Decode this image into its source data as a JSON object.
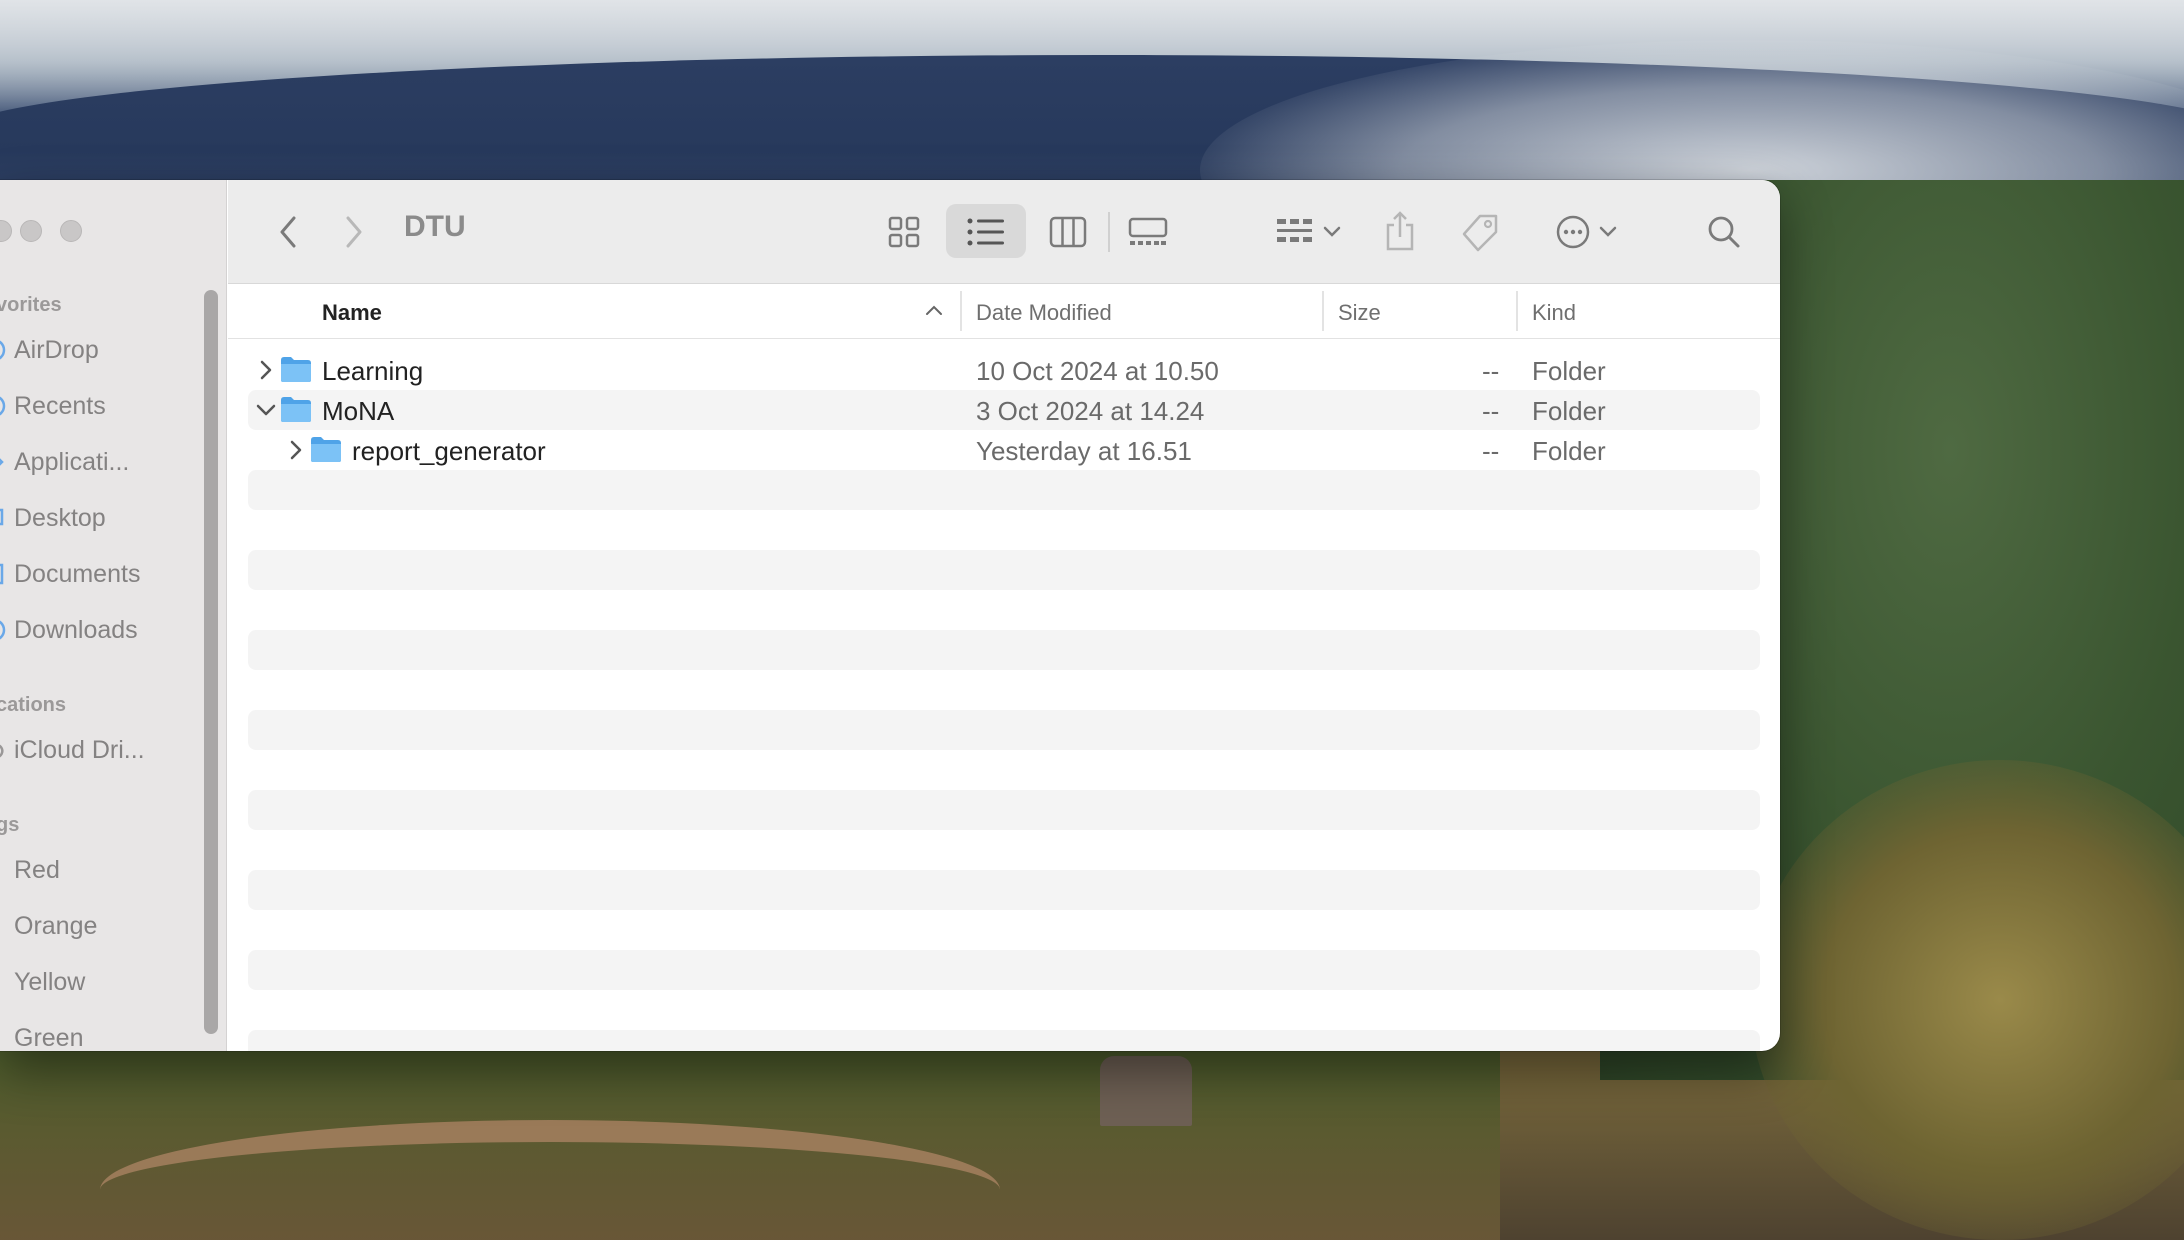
{
  "window": {
    "title": "DTU"
  },
  "sidebar": {
    "sections": [
      {
        "key": "favorites",
        "label": "vorites"
      },
      {
        "key": "locations",
        "label": "cations"
      },
      {
        "key": "tags",
        "label": "gs"
      }
    ],
    "favorites": [
      {
        "label": "AirDrop",
        "icon": "airdrop-icon"
      },
      {
        "label": "Recents",
        "icon": "clock-icon"
      },
      {
        "label": "Applicati...",
        "icon": "applications-icon"
      },
      {
        "label": "Desktop",
        "icon": "desktop-icon"
      },
      {
        "label": "Documents",
        "icon": "document-icon"
      },
      {
        "label": "Downloads",
        "icon": "download-icon"
      }
    ],
    "locations": [
      {
        "label": "iCloud Dri...",
        "icon": "cloud-icon"
      }
    ],
    "tags": [
      {
        "label": "Red",
        "color": "#ff5b55"
      },
      {
        "label": "Orange",
        "color": "#ff9f0a"
      },
      {
        "label": "Yellow",
        "color": "#ffd60a"
      },
      {
        "label": "Green",
        "color": "#32d74b"
      }
    ]
  },
  "toolbar": {
    "views": [
      "icon-view",
      "list-view",
      "column-view",
      "gallery-view"
    ],
    "active_view": "list-view"
  },
  "columns": {
    "name": "Name",
    "date": "Date Modified",
    "size": "Size",
    "kind": "Kind"
  },
  "rows": [
    {
      "name": "Learning",
      "date": "10 Oct 2024 at 10.50",
      "size": "--",
      "kind": "Folder",
      "expanded": false,
      "level": 0
    },
    {
      "name": "MoNA",
      "date": "3 Oct 2024 at 14.24",
      "size": "--",
      "kind": "Folder",
      "expanded": true,
      "level": 0
    },
    {
      "name": "report_generator",
      "date": "Yesterday at 16.51",
      "size": "--",
      "kind": "Folder",
      "expanded": false,
      "level": 1
    }
  ],
  "colors": {
    "folder": "#6ab8f4",
    "row_alt": "#f4f4f4",
    "sidebar_bg": "#e8e6e6"
  }
}
